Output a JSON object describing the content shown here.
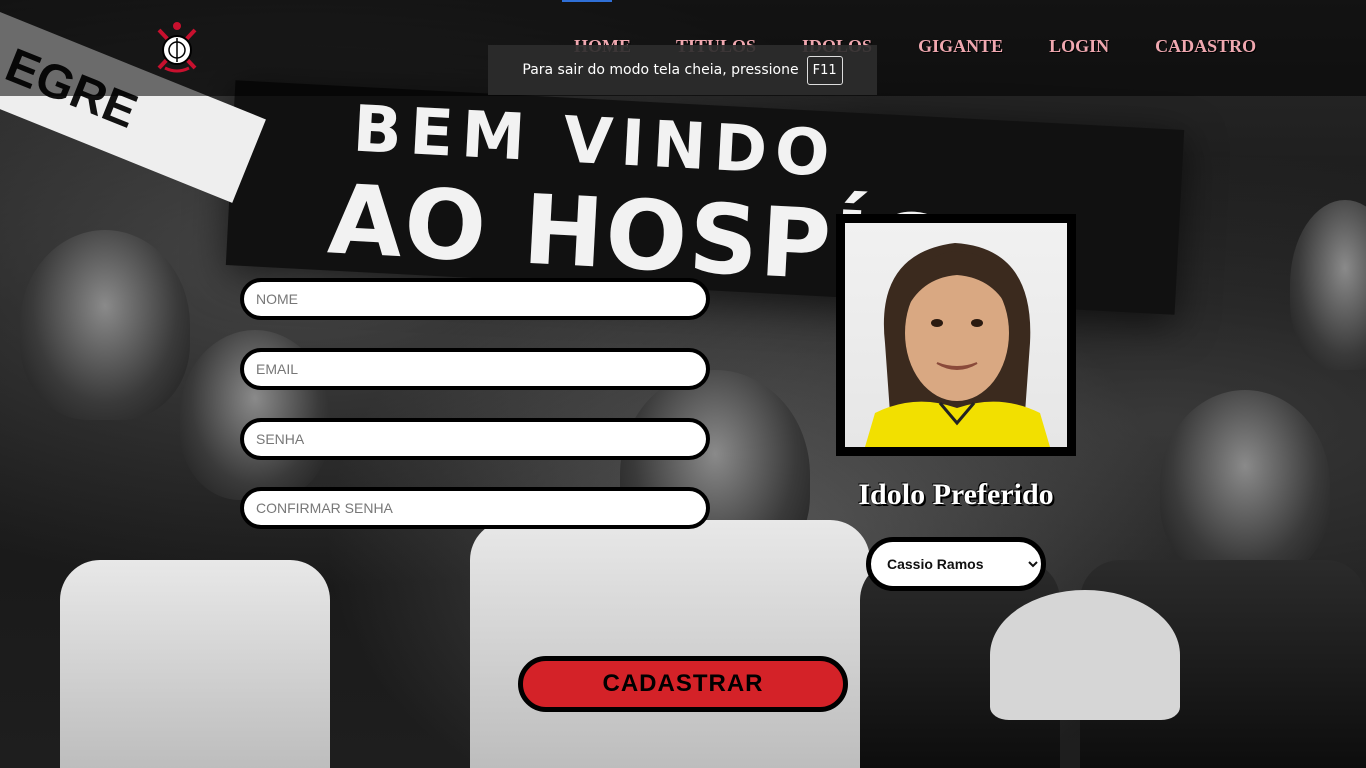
{
  "header": {
    "logo_icon": "corinthians-crest-icon",
    "nav": [
      {
        "label": "HOME"
      },
      {
        "label": "TITULOS"
      },
      {
        "label": "IDOLOS"
      },
      {
        "label": "GIGANTE"
      },
      {
        "label": "LOGIN"
      },
      {
        "label": "CADASTRO"
      }
    ]
  },
  "fullscreen_notice": {
    "text": "Para sair do modo tela cheia, pressione",
    "key": "F11"
  },
  "background": {
    "scarf_line1": "BEM VINDO",
    "scarf_line2": "AO HOSPÍCIO",
    "scarf_left": "EGRE"
  },
  "form": {
    "nome_placeholder": "NOME",
    "email_placeholder": "EMAIL",
    "senha_placeholder": "SENHA",
    "confirmar_placeholder": "CONFIRMAR SENHA",
    "submit_label": "CADASTRAR"
  },
  "idol": {
    "title": "Idolo Preferido",
    "selected": "Cassio Ramos",
    "photo_icon": "player-portrait-photo"
  },
  "colors": {
    "nav_link": "#f0a8b0",
    "submit_bg": "#d42228",
    "jersey_yellow": "#f2e000"
  }
}
